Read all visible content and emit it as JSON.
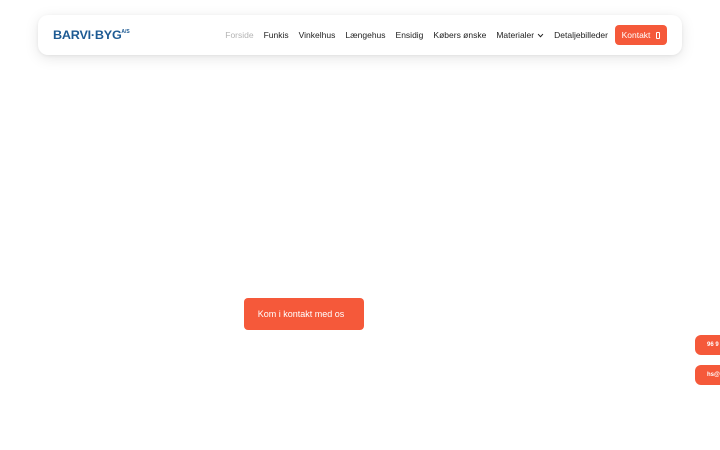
{
  "header": {
    "logo_text": "BARVI·BYG",
    "logo_mark": "A/S"
  },
  "nav": {
    "items": [
      {
        "label": "Forside",
        "active": true
      },
      {
        "label": "Funkis"
      },
      {
        "label": "Vinkelhus"
      },
      {
        "label": "Længehus"
      },
      {
        "label": "Ensidig"
      },
      {
        "label": "Købers ønske"
      },
      {
        "label": "Materialer",
        "has_dropdown": true
      },
      {
        "label": "Detaljebilleder"
      }
    ],
    "contact_label": "Kontakt"
  },
  "hero": {
    "cta_label": "Kom i kontakt med os"
  },
  "side_tabs": {
    "phone_label": "96 9",
    "email_label": "hs@"
  },
  "colors": {
    "accent": "#f5593a",
    "logo": "#1d5a93",
    "nav_text": "#222222",
    "nav_active": "#b4b4b4"
  },
  "icons": {
    "dropdown": "chevron-down-icon",
    "contact": "phone-icon"
  }
}
